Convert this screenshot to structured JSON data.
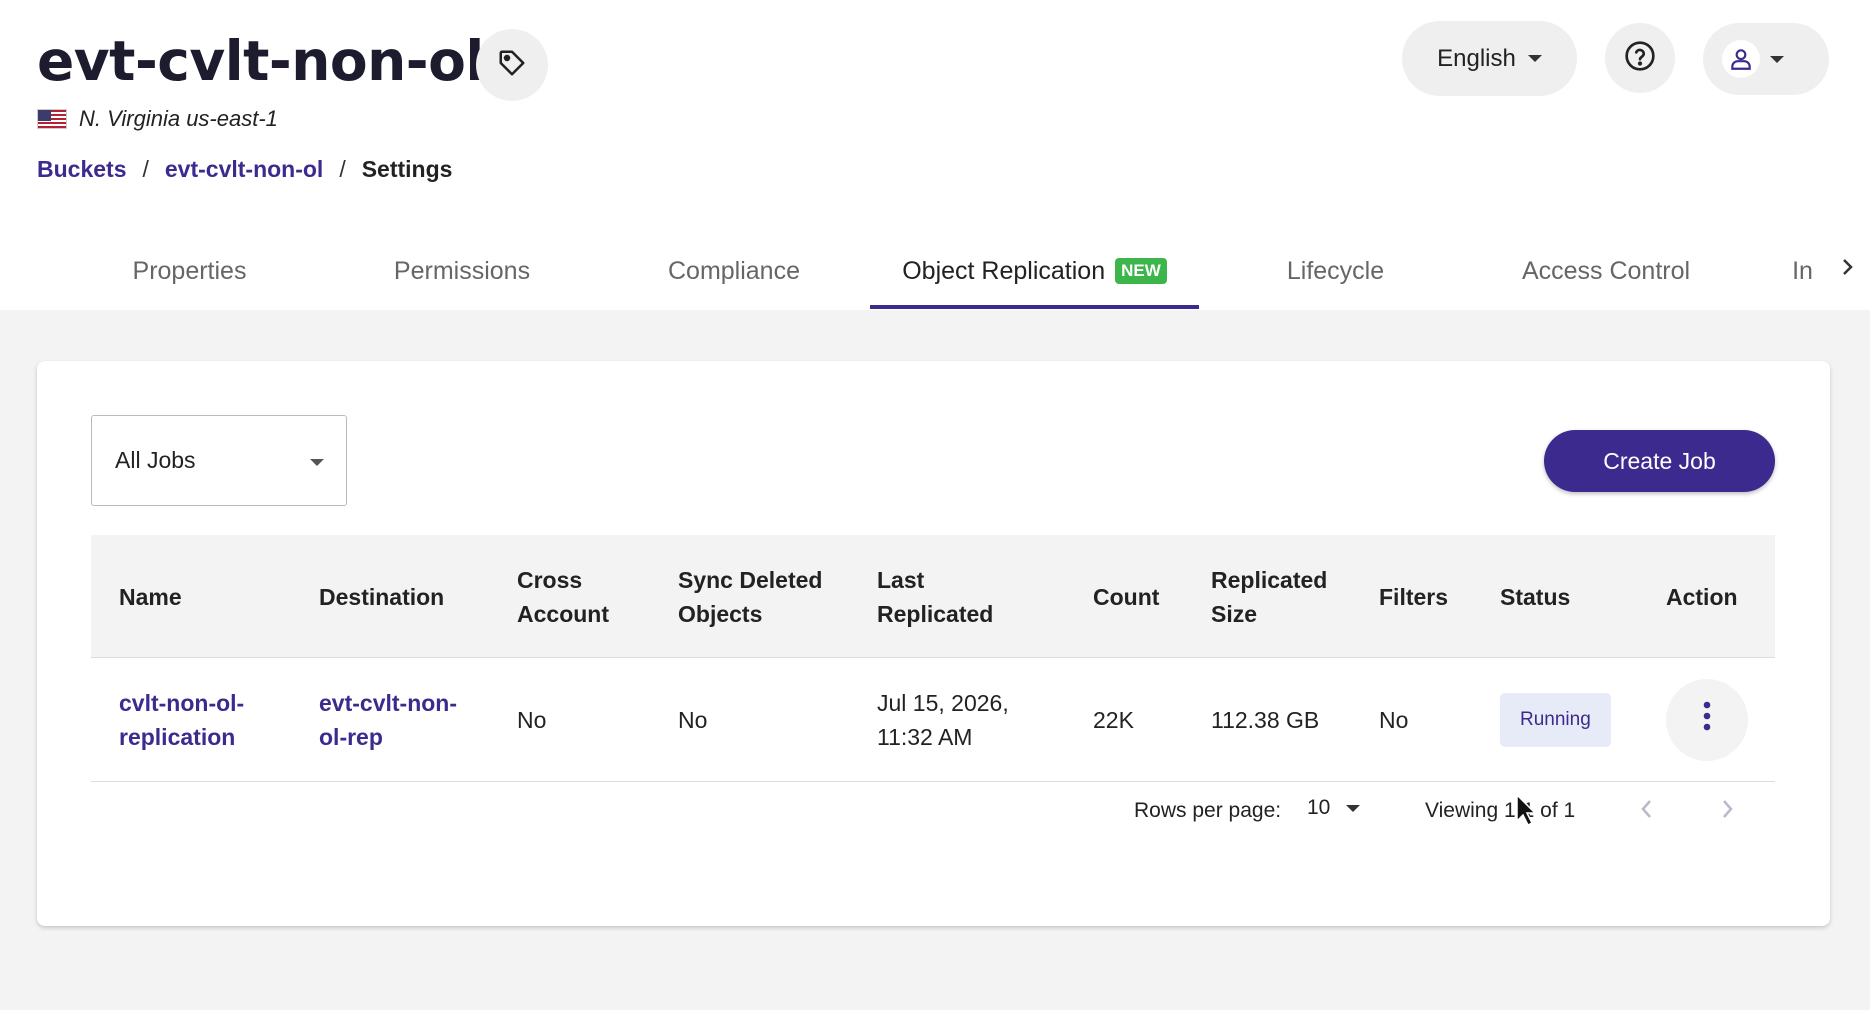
{
  "header": {
    "bucket_name": "evt-cvlt-non-ol",
    "region": "N. Virginia us-east-1",
    "language": "English"
  },
  "breadcrumb": {
    "items": [
      "Buckets",
      "evt-cvlt-non-ol",
      "Settings"
    ],
    "separator": "/"
  },
  "tabs": {
    "items": [
      {
        "label": "Properties"
      },
      {
        "label": "Permissions"
      },
      {
        "label": "Compliance"
      },
      {
        "label": "Object Replication",
        "badge": "NEW",
        "active": true
      },
      {
        "label": "Lifecycle"
      },
      {
        "label": "Access Control"
      },
      {
        "label": "In"
      }
    ]
  },
  "toolbar": {
    "filter_value": "All Jobs",
    "create_label": "Create Job"
  },
  "table": {
    "headers": {
      "name": "Name",
      "destination": "Destination",
      "cross_account": "Cross Account",
      "sync_deleted": "Sync Deleted Objects",
      "last_replicated": "Last Replicated",
      "count": "Count",
      "replicated_size": "Replicated Size",
      "filters": "Filters",
      "status": "Status",
      "action": "Action"
    },
    "rows": [
      {
        "name": "cvlt-non-ol-replication",
        "destination": "evt-cvlt-non-ol-rep",
        "cross_account": "No",
        "sync_deleted": "No",
        "last_replicated": "Jul 15, 2026, 11:32 AM",
        "count": "22K",
        "replicated_size": "112.38 GB",
        "filters": "No",
        "status": "Running"
      }
    ]
  },
  "pagination": {
    "rows_per_page_label": "Rows per page:",
    "rows_per_page": "10",
    "viewing": "Viewing 1-1 of 1"
  },
  "colors": {
    "accent": "#3d2a8e",
    "new_badge": "#3cb54a",
    "status_bg": "#e7ebf7",
    "page_bg": "#f3f3f3"
  },
  "icons": {
    "tag": "tag-icon",
    "help": "help-circle-icon",
    "user": "user-icon",
    "more": "more-vertical-icon"
  }
}
